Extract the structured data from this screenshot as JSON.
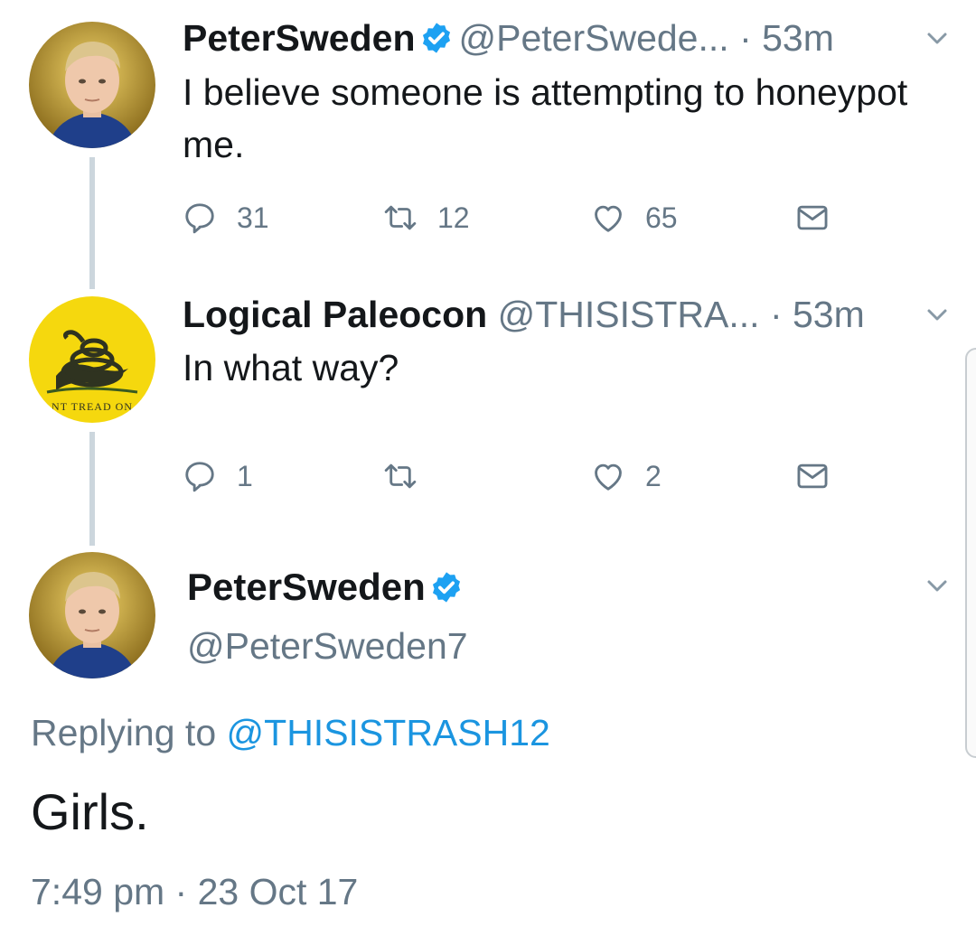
{
  "colors": {
    "accent": "#1da1f2",
    "link": "#1b95e0",
    "muted": "#657786",
    "text": "#14171a",
    "thread_line": "#ccd6dd",
    "gadsden_yellow": "#f5d80e"
  },
  "tweets": [
    {
      "name": "PeterSweden",
      "verified": true,
      "handle": "@PeterSwede...",
      "time": "· 53m",
      "text": "I believe someone is attempting to honeypot me.",
      "replies": "31",
      "retweets": "12",
      "likes": "65",
      "avatar": "peter-avatar"
    },
    {
      "name": "Logical Paleocon",
      "verified": false,
      "handle": "@THISISTRA...",
      "time": "· 53m",
      "text": "In what way?",
      "replies": "1",
      "retweets": "",
      "likes": "2",
      "avatar": "gadsden-flag-avatar",
      "avatar_text": "NT TREAD ON"
    }
  ],
  "main_tweet": {
    "name": "PeterSweden",
    "verified": true,
    "handle": "@PeterSweden7",
    "replying_prefix": "Replying to",
    "replying_to": "@THISISTRASH12",
    "text": "Girls.",
    "timestamp": "7:49 pm · 23 Oct 17"
  },
  "icons": [
    "reply-icon",
    "retweet-icon",
    "like-icon",
    "direct-message-icon",
    "verified-badge-icon",
    "chevron-down-icon"
  ]
}
